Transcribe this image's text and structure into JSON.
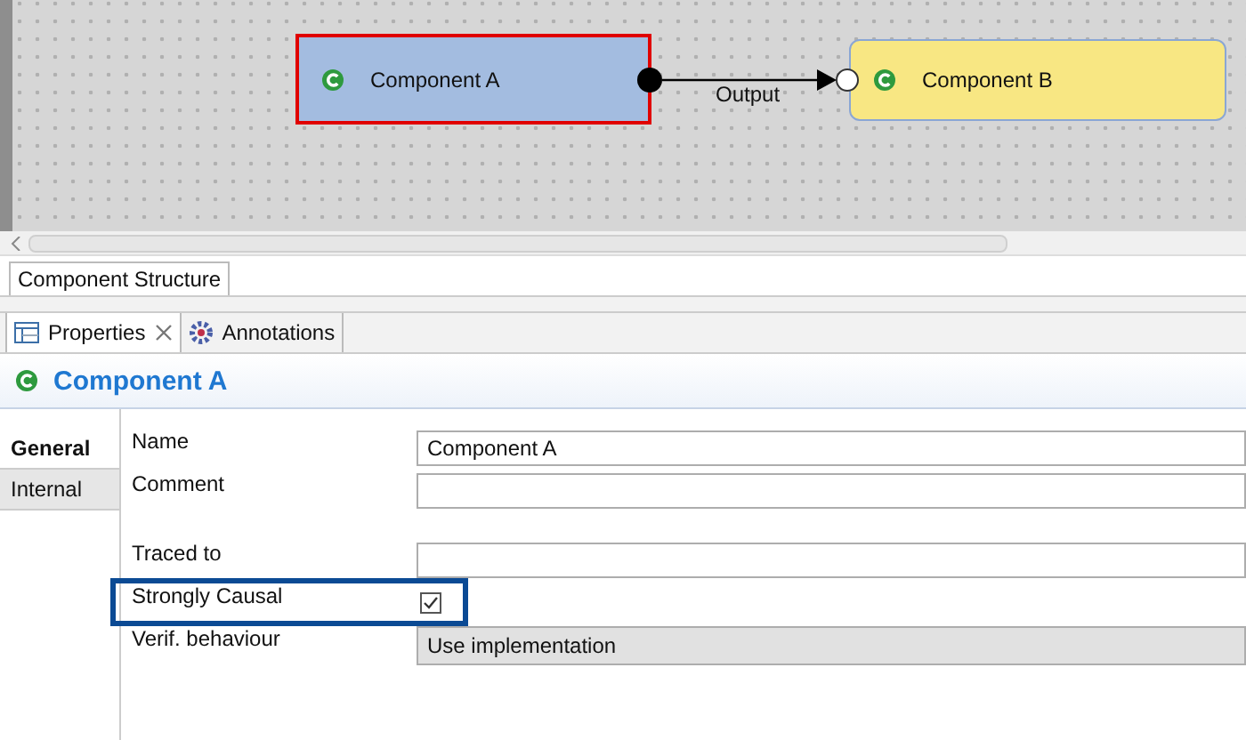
{
  "diagram": {
    "nodes": [
      {
        "label": "Component A",
        "selected": true,
        "color": "#a3bce0"
      },
      {
        "label": "Component B",
        "selected": false,
        "color": "#f8e783"
      }
    ],
    "connection": {
      "label": "Output"
    }
  },
  "editor_tabs": [
    {
      "label": "Component Structure",
      "selected": true
    }
  ],
  "panel_tabs": [
    {
      "label": "Properties",
      "selected": true,
      "closable": true
    },
    {
      "label": "Annotations",
      "selected": false,
      "closable": false
    }
  ],
  "header": {
    "title": "Component A"
  },
  "side_tabs": [
    {
      "label": "General",
      "selected": true
    },
    {
      "label": "Internal",
      "selected": false
    }
  ],
  "fields": [
    {
      "kind": "text",
      "label": "Name",
      "value": "Component A",
      "highlighted": false
    },
    {
      "kind": "text",
      "label": "Comment",
      "highlighted": false
    },
    {
      "kind": "spacer"
    },
    {
      "kind": "text",
      "label": "Traced to",
      "highlighted": false
    },
    {
      "kind": "checkbox",
      "label": "Strongly Causal",
      "checked": true,
      "highlighted": true
    },
    {
      "kind": "combo",
      "label": "Verif. behaviour",
      "value": "Use implementation",
      "highlighted": false
    }
  ]
}
